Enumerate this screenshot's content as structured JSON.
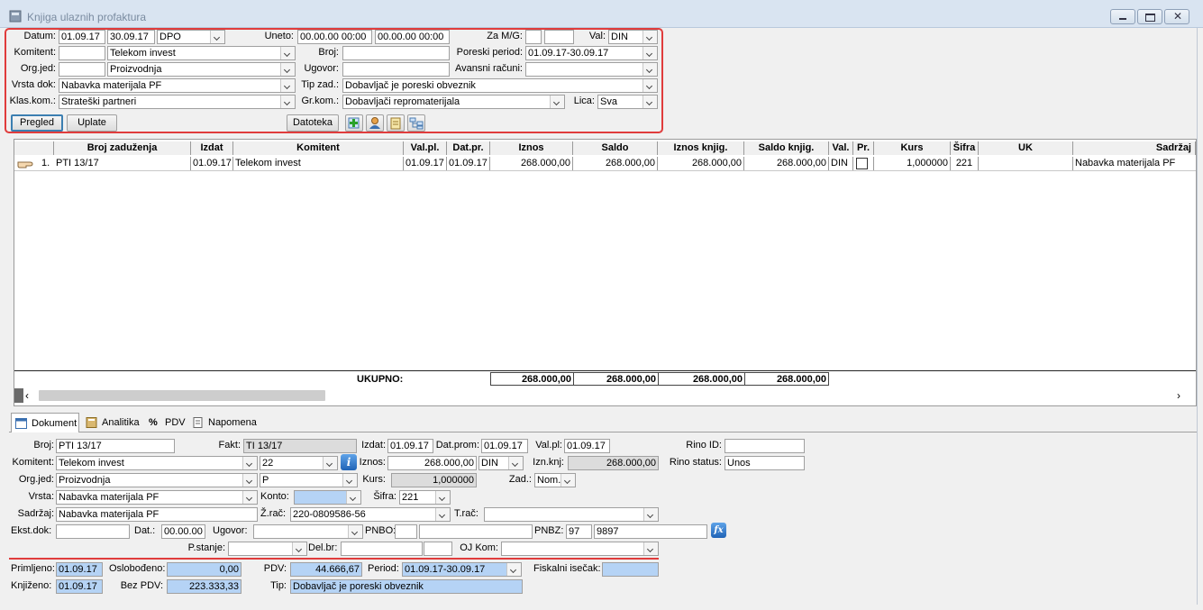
{
  "window": {
    "title": "Knjiga ulaznih profaktura"
  },
  "filter": {
    "datum_label": "Datum:",
    "datum_from": "01.09.17",
    "datum_to": "30.09.17",
    "datum_type": "DPO",
    "uneto_label": "Uneto:",
    "uneto_from": "00.00.00 00:00",
    "uneto_to": "00.00.00 00:00",
    "zamg_label": "Za M/G:",
    "zamg_m": "",
    "zamg_g": "",
    "val_label": "Val:",
    "val_value": "DIN",
    "komitent_label": "Komitent:",
    "komitent_code": "",
    "komitent_name": "Telekom invest",
    "broj_label": "Broj:",
    "broj_value": "",
    "poreski_label": "Poreski period:",
    "poreski_value": "01.09.17-30.09.17",
    "orgjed_label": "Org.jed:",
    "orgjed_code": "",
    "orgjed_name": "Proizvodnja",
    "ugovor_label": "Ugovor:",
    "ugovor_value": "",
    "avansni_label": "Avansni računi:",
    "avansni_value": "",
    "vrsta_label": "Vrsta dok:",
    "vrsta_value": "Nabavka materijala PF",
    "tipzad_label": "Tip zad.:",
    "tipzad_value": "Dobavljač je poreski obveznik",
    "klaskom_label": "Klas.kom.:",
    "klaskom_value": "Strateški partneri",
    "grkom_label": "Gr.kom.:",
    "grkom_value": "Dobavljači repromaterijala",
    "lica_label": "Lica:",
    "lica_value": "Sva",
    "pregled_label": "Pregled",
    "uplate_label": "Uplate",
    "datoteka_label": "Datoteka"
  },
  "grid": {
    "columns": [
      "Broj zaduženja",
      "Izdat",
      "Komitent",
      "Val.pl.",
      "Dat.pr.",
      "Iznos",
      "Saldo",
      "Iznos knjig.",
      "Saldo knjig.",
      "Val.",
      "Pr.",
      "Kurs",
      "Šifra",
      "UK",
      "Sadržaj"
    ],
    "rows": [
      {
        "num": "1.",
        "broj": "PTI 13/17",
        "izdat": "01.09.17",
        "komitent": "Telekom invest",
        "valpl": "01.09.17",
        "datpr": "01.09.17",
        "iznos": "268.000,00",
        "saldo": "268.000,00",
        "iznos_knjig": "268.000,00",
        "saldo_knjig": "268.000,00",
        "val": "DIN",
        "kurs": "1,000000",
        "sifra": "221",
        "uk": "",
        "sadrzaj": "Nabavka materijala PF"
      }
    ],
    "total_label": "UKUPNO:",
    "totals": [
      "268.000,00",
      "268.000,00",
      "268.000,00",
      "268.000,00"
    ]
  },
  "tabs": [
    "Dokument",
    "Analitika",
    "PDV",
    "Napomena"
  ],
  "form": {
    "broj_label": "Broj:",
    "broj": "PTI 13/17",
    "fakt_label": "Fakt:",
    "fakt": "TI 13/17",
    "izdat_label": "Izdat:",
    "izdat": "01.09.17",
    "datprom_label": "Dat.prom:",
    "datprom": "01.09.17",
    "valpl_label": "Val.pl:",
    "valpl": "01.09.17",
    "rinoid_label": "Rino ID:",
    "rinoid": "",
    "komitent_label": "Komitent:",
    "komitent": "Telekom invest",
    "komitent_code": "22",
    "iznos_label": "Iznos:",
    "iznos": "268.000,00",
    "valuta": "DIN",
    "iznknj_label": "Izn.knj:",
    "iznknj": "268.000,00",
    "rinostatus_label": "Rino status:",
    "rinostatus": "Unos",
    "orgjed_label": "Org.jed:",
    "orgjed": "Proizvodnja",
    "orgjed_p": "P",
    "kurs_label": "Kurs:",
    "kurs": "1,000000",
    "zad_label": "Zad.:",
    "zad": "Nom.",
    "vrsta_label": "Vrsta:",
    "vrsta": "Nabavka materijala PF",
    "konto_label": "Konto:",
    "konto": "",
    "sifra_label": "Šifra:",
    "sifra": "221",
    "sadrzaj_label": "Sadržaj:",
    "sadrzaj": "Nabavka materijala PF",
    "zrac_label": "Ž.rač:",
    "zrac": "220-0809586-56",
    "trac_label": "T.rač:",
    "trac": "",
    "ekstdok_label": "Ekst.dok:",
    "ekstdok": "",
    "dat_label": "Dat.:",
    "dat": "00.00.00",
    "ugovor_label": "Ugovor:",
    "ugovor": "",
    "pnbo_label": "PNBO:",
    "pnbo": "",
    "pnbz_label": "PNBZ:",
    "pnbz1": "97",
    "pnbz2": "9897",
    "pstanje_label": "P.stanje:",
    "pstanje": "",
    "delbr_label": "Del.br:",
    "delbr": "",
    "ojkom_label": "OJ Kom:",
    "ojkom": "",
    "primljeno_label": "Primljeno:",
    "primljeno": "01.09.17",
    "oslobodjeno_label": "Oslobođeno:",
    "oslobodjeno": "0,00",
    "pdv_label": "PDV:",
    "pdv": "44.666,67",
    "period_label": "Period:",
    "period": "01.09.17-30.09.17",
    "fiskalni_label": "Fiskalni isečak:",
    "fiskalni": "",
    "knjizeno_label": "Knjiženo:",
    "knjizeno": "01.09.17",
    "bezpdv_label": "Bez PDV:",
    "bezpdv": "223.333,33",
    "tip_label": "Tip:",
    "tip": "Dobavljač je poreski obveznik"
  },
  "colors": {
    "highlight_border": "#e03c3c",
    "readonly_blue": "#b5d3f5",
    "titlebar": "#d9e4f1"
  }
}
